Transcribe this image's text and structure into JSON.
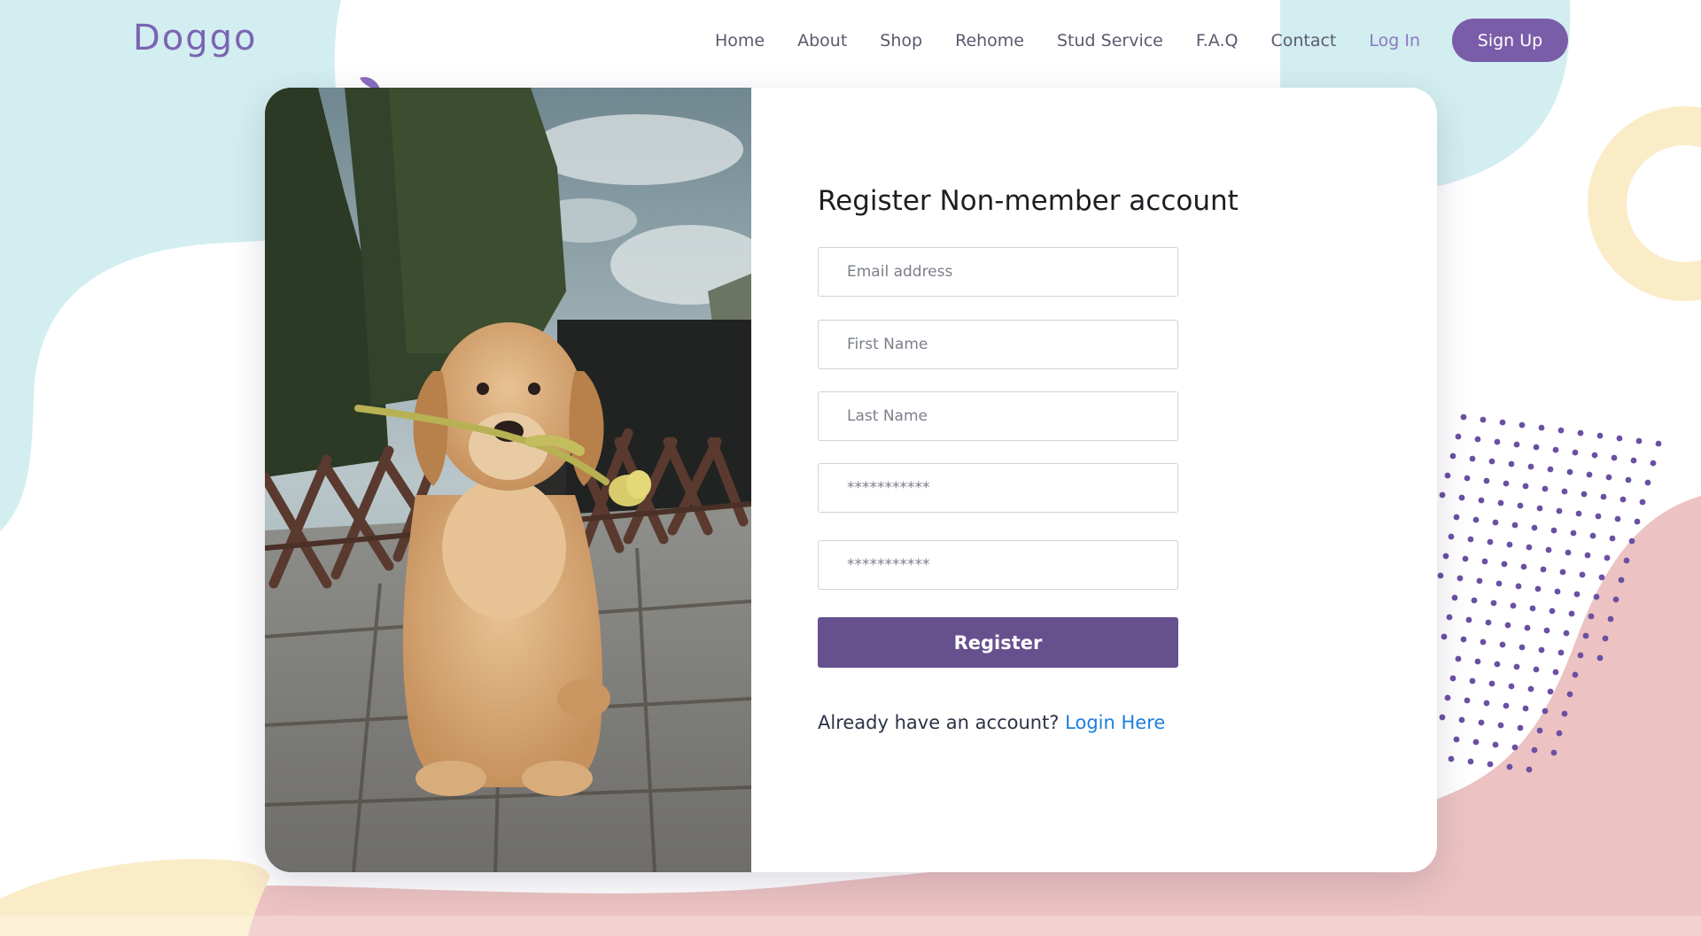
{
  "header": {
    "logo": "Doggo",
    "nav": [
      "Home",
      "About",
      "Shop",
      "Rehome",
      "Stud Service",
      "F.A.Q",
      "Contact",
      "Log In"
    ],
    "signup_label": "Sign Up"
  },
  "form": {
    "title": "Register Non-member account",
    "fields": [
      {
        "placeholder": "Email address",
        "type": "email"
      },
      {
        "placeholder": "First Name",
        "type": "text"
      },
      {
        "placeholder": "Last Name",
        "type": "text"
      },
      {
        "placeholder": "***********",
        "type": "password"
      },
      {
        "placeholder": "***********",
        "type": "password"
      }
    ],
    "register_label": "Register",
    "account_prompt": "Already have an account?",
    "login_link": "Login Here"
  },
  "colors": {
    "brand": "#7a5da8",
    "register_button": "#67508e",
    "link": "#1e7ee0",
    "bg_teal": "#d2eef0",
    "bg_pink": "#ecc3c2",
    "bg_cream": "#fbecc8"
  },
  "icons": {
    "hero_image": "dog-with-flower-photo"
  }
}
